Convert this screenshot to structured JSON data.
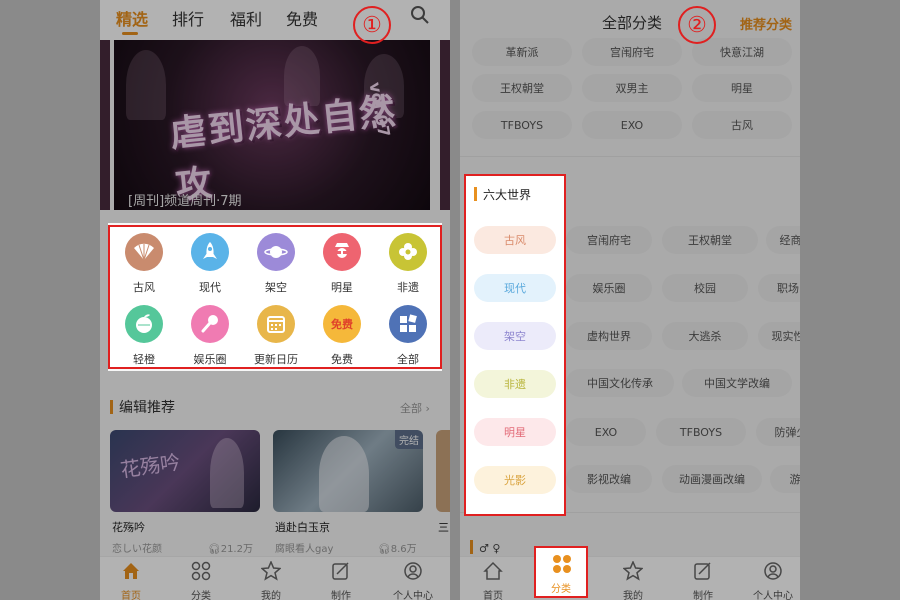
{
  "left_screen": {
    "tabs": [
      "精选",
      "排行",
      "福利",
      "免费"
    ],
    "banner": {
      "title": "虐到深处自然攻",
      "vol": "vol.07",
      "caption": "[周刊]频道周刊·7期"
    },
    "categories": [
      {
        "label": "古风",
        "icon": "fan-icon",
        "color": "#c98b6e"
      },
      {
        "label": "现代",
        "icon": "rocket-icon",
        "color": "#5ab3e8"
      },
      {
        "label": "架空",
        "icon": "planet-icon",
        "color": "#9c8ad8"
      },
      {
        "label": "明星",
        "icon": "star-person-icon",
        "color": "#ee6470"
      },
      {
        "label": "非遗",
        "icon": "flower-icon",
        "color": "#c8c435"
      },
      {
        "label": "轻橙",
        "icon": "orange-icon",
        "color": "#55c79a"
      },
      {
        "label": "娱乐圈",
        "icon": "microphone-icon",
        "color": "#f07bb2"
      },
      {
        "label": "更新日历",
        "icon": "calendar-icon",
        "color": "#e8b64a"
      },
      {
        "label": "免费",
        "icon": "free-tag-icon",
        "color": "#f5b83a",
        "icon_text": "免费"
      },
      {
        "label": "全部",
        "icon": "grid-icon",
        "color": "#4f72b6"
      }
    ],
    "section": {
      "title": "编辑推荐",
      "more": "全部 ›"
    },
    "cards": [
      {
        "title": "花殇吟",
        "author": "恋しい花颜",
        "plays": "21.2万",
        "image_text": "花殇吟"
      },
      {
        "title": "逍赴白玉京",
        "author": "腐眼看人gay",
        "plays": "8.6万",
        "badge": "完结"
      },
      {
        "title": "三",
        "author": "",
        "plays": ""
      }
    ],
    "bottom_nav": [
      {
        "label": "首页",
        "icon": "home-icon",
        "active": true
      },
      {
        "label": "分类",
        "icon": "category-icon"
      },
      {
        "label": "我的",
        "icon": "star-icon"
      },
      {
        "label": "制作",
        "icon": "edit-icon"
      },
      {
        "label": "个人中心",
        "icon": "user-icon"
      }
    ]
  },
  "right_screen": {
    "header_title": "全部分类",
    "header_right": "推荐分类",
    "top_tags": [
      [
        "革新派",
        "宫闱府宅",
        "快意江湖"
      ],
      [
        "王权朝堂",
        "双男主",
        "明星"
      ],
      [
        "TFBOYS",
        "EXO",
        "古风"
      ]
    ],
    "worlds_title": "六大世界",
    "worlds": [
      {
        "label": "古风",
        "bg": "#fbe9e0",
        "fg": "#d98a6a"
      },
      {
        "label": "现代",
        "bg": "#e3f2fc",
        "fg": "#5aa9dc"
      },
      {
        "label": "架空",
        "bg": "#ecebfa",
        "fg": "#8e86cf"
      },
      {
        "label": "非遗",
        "bg": "#f3f5da",
        "fg": "#b8b43a"
      },
      {
        "label": "明星",
        "bg": "#fde8ea",
        "fg": "#e36b78"
      },
      {
        "label": "光影",
        "bg": "#fdf2dc",
        "fg": "#d9a33e"
      }
    ],
    "right_tags": [
      [
        "宫闱府宅",
        "王权朝堂",
        "经商种"
      ],
      [
        "娱乐圈",
        "校园",
        "职场"
      ],
      [
        "虚构世界",
        "大逃杀",
        "现实性"
      ],
      [
        "中国文化传承",
        "中国文学改编",
        ""
      ],
      [
        "EXO",
        "TFBOYS",
        "防弹少"
      ],
      [
        "影视改编",
        "动画漫画改编",
        "游"
      ]
    ],
    "bottom_nav": [
      {
        "label": "首页",
        "icon": "home-icon"
      },
      {
        "label": "分类",
        "icon": "category-icon",
        "active": true
      },
      {
        "label": "我的",
        "icon": "star-icon"
      },
      {
        "label": "制作",
        "icon": "edit-icon"
      },
      {
        "label": "个人中心",
        "icon": "user-icon"
      }
    ]
  },
  "annotations": {
    "marker_1": "①",
    "marker_2": "②"
  },
  "colors": {
    "accent": "#e8901f",
    "highlight": "#e02020"
  }
}
